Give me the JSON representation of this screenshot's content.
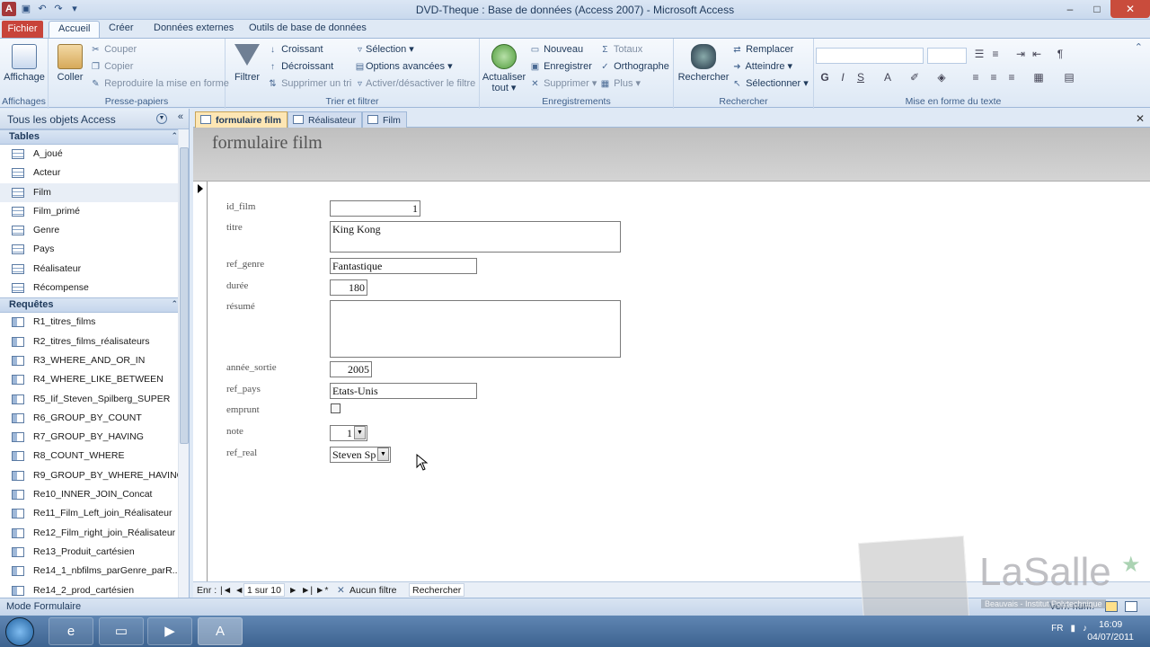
{
  "window": {
    "title": "DVD-Theque : Base de données (Access 2007)  -  Microsoft Access",
    "app_icon": "A",
    "controls": {
      "minimize": "–",
      "maximize": "□",
      "close": "✕"
    }
  },
  "ribbon_tabs": {
    "file": "Fichier",
    "home": "Accueil",
    "create": "Créer",
    "external": "Données externes",
    "dbtools": "Outils de base de données"
  },
  "ribbon": {
    "views": {
      "label": "Affichages",
      "view_button": "Affichage"
    },
    "clipboard": {
      "label": "Presse-papiers",
      "paste": "Coller",
      "cut": "Couper",
      "copy": "Copier",
      "format_painter": "Reproduire la mise en forme"
    },
    "sort_filter": {
      "label": "Trier et filtrer",
      "filter": "Filtrer",
      "ascending": "Croissant",
      "descending": "Décroissant",
      "remove_sort": "Supprimer un tri",
      "selection": "Sélection ▾",
      "advanced": "Options avancées ▾",
      "toggle_filter": "Activer/désactiver le filtre"
    },
    "records": {
      "label": "Enregistrements",
      "refresh": "Actualiser",
      "refresh_sub": "tout ▾",
      "new": "Nouveau",
      "save": "Enregistrer",
      "delete": "Supprimer ▾",
      "totals": "Totaux",
      "spelling": "Orthographe",
      "more": "Plus ▾"
    },
    "find": {
      "label": "Rechercher",
      "find": "Rechercher",
      "replace": "Remplacer",
      "goto": "Atteindre ▾",
      "select": "Sélectionner ▾"
    },
    "text_format": {
      "label": "Mise en forme du texte",
      "bold": "G",
      "italic": "I",
      "underline": "S"
    }
  },
  "nav_pane": {
    "header": "Tous les objets Access",
    "tables_header": "Tables",
    "tables": [
      "A_joué",
      "Acteur",
      "Film",
      "Film_primé",
      "Genre",
      "Pays",
      "Réalisateur",
      "Récompense"
    ],
    "queries_header": "Requêtes",
    "queries": [
      "R1_titres_films",
      "R2_titres_films_réalisateurs",
      "R3_WHERE_AND_OR_IN",
      "R4_WHERE_LIKE_BETWEEN",
      "R5_Iif_Steven_Spilberg_SUPER",
      "R6_GROUP_BY_COUNT",
      "R7_GROUP_BY_HAVING",
      "R8_COUNT_WHERE",
      "R9_GROUP_BY_WHERE_HAVING",
      "Re10_INNER_JOIN_Concat",
      "Re11_Film_Left_join_Réalisateur",
      "Re12_Film_right_join_Réalisateur",
      "Re13_Produit_cartésien",
      "Re14_1_nbfilms_parGenre_parR...",
      "Re14_2_prod_cartésien"
    ]
  },
  "doc_tabs": [
    "formulaire film",
    "Réalisateur",
    "Film"
  ],
  "form": {
    "title": "formulaire film",
    "fields": {
      "id_film": {
        "label": "id_film",
        "value": "1"
      },
      "titre": {
        "label": "titre",
        "value": "King Kong"
      },
      "ref_genre": {
        "label": "ref_genre",
        "value": "Fantastique"
      },
      "duree": {
        "label": "durée",
        "value": "180"
      },
      "resume": {
        "label": "résumé",
        "value": ""
      },
      "annee_sortie": {
        "label": "année_sortie",
        "value": "2005"
      },
      "ref_pays": {
        "label": "ref_pays",
        "value": "Etats-Unis"
      },
      "emprunt": {
        "label": "emprunt",
        "checked": false
      },
      "note": {
        "label": "note",
        "value": "1"
      },
      "ref_real": {
        "label": "ref_real",
        "value": "Steven Sp"
      }
    }
  },
  "record_nav": {
    "prefix": "Enr :",
    "first": "|◄",
    "prev": "◄",
    "position": "1 sur 10",
    "next": "►",
    "last": "►|",
    "new": "►*",
    "filter": "Aucun filtre",
    "search": "Rechercher"
  },
  "status": {
    "mode": "Mode Formulaire",
    "right": "Verr. num."
  },
  "taskbar": {
    "lang": "FR",
    "time": "16:09",
    "date": "04/07/2011"
  },
  "watermark": {
    "brand": "LaSalle",
    "sub": "Beauvais - Institut Polytechnique"
  }
}
